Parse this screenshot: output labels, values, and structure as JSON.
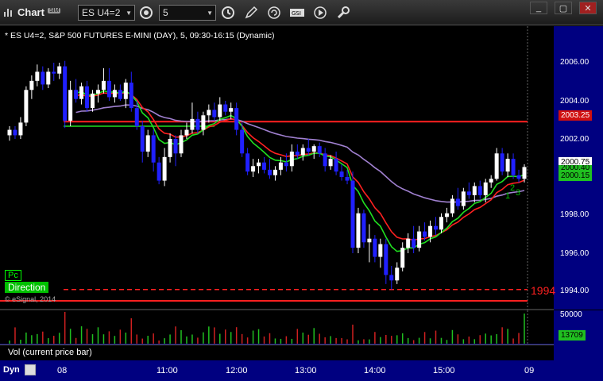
{
  "titlebar": {
    "app_title": "Chart",
    "sim_badge": "SIM",
    "symbol_value": "ES U4=2",
    "interval_value": "5",
    "icons": [
      "link-icon",
      "clock-icon",
      "pencil-icon",
      "refresh-icon",
      "gsi-icon",
      "play-icon",
      "tools-icon"
    ],
    "win_buttons": [
      "_",
      "▢",
      "✕"
    ]
  },
  "chart": {
    "title": "* ES U4=2, S&P 500 FUTURES E-MINI (DAY), 5, 09:30-16:15 (Dynamic)",
    "price_ticks": [
      "2006.00",
      "2004.00",
      "2002.00",
      "2000.00",
      "1998.00",
      "1996.00",
      "1994.00"
    ],
    "price_markers": {
      "red_level": "2003.25",
      "last": "2000.75",
      "green_a": "2000.40",
      "green_b": "2000.15"
    },
    "level_label": "1994",
    "pc_label": "Pc",
    "direction_label": "Direction",
    "copyright": "© eSignal, 2014",
    "counts": [
      "1",
      "2",
      "3"
    ],
    "time_ticks": [
      "08",
      "11:00",
      "12:00",
      "13:00",
      "14:00",
      "15:00",
      "09"
    ]
  },
  "volume": {
    "label": "Vol (current price bar)",
    "scale": "50000",
    "current": "13709"
  },
  "footer": {
    "dyn_label": "Dyn"
  },
  "colors": {
    "up": "#ffffff",
    "down": "#2020ff",
    "ma_red": "#ff2020",
    "ma_green": "#20e020",
    "ma_purple": "#a080d0",
    "axis_bg": "#000080"
  },
  "chart_data": {
    "type": "candlestick",
    "ylim": [
      1993.2,
      2007.2
    ],
    "levels": {
      "resistance": 2003.25,
      "support": 1994.0,
      "green_level": 2003.0
    },
    "candles": [
      [
        2002.5,
        2003.0,
        2002.2,
        2002.8
      ],
      [
        2002.8,
        2003.0,
        2002.3,
        2002.5
      ],
      [
        2002.5,
        2003.5,
        2002.3,
        2003.2
      ],
      [
        2003.2,
        2005.2,
        2003.0,
        2005.0
      ],
      [
        2005.0,
        2005.8,
        2004.5,
        2005.5
      ],
      [
        2005.5,
        2006.4,
        2005.2,
        2006.0
      ],
      [
        2006.0,
        2006.3,
        2005.0,
        2005.3
      ],
      [
        2005.3,
        2006.2,
        2005.1,
        2006.0
      ],
      [
        2006.0,
        2006.5,
        2005.5,
        2005.9
      ],
      [
        2005.9,
        2006.5,
        2005.6,
        2006.3
      ],
      [
        2006.3,
        2006.6,
        2002.9,
        2003.3
      ],
      [
        2003.3,
        2005.5,
        2003.0,
        2005.0
      ],
      [
        2005.0,
        2005.6,
        2004.3,
        2004.5
      ],
      [
        2004.5,
        2005.4,
        2004.2,
        2005.2
      ],
      [
        2005.2,
        2005.5,
        2003.8,
        2004.0
      ],
      [
        2004.0,
        2005.0,
        2003.8,
        2004.8
      ],
      [
        2004.8,
        2005.3,
        2004.3,
        2005.0
      ],
      [
        2005.0,
        2006.2,
        2004.8,
        2005.5
      ],
      [
        2005.5,
        2006.2,
        2004.4,
        2004.6
      ],
      [
        2004.6,
        2005.3,
        2004.3,
        2005.0
      ],
      [
        2005.0,
        2005.3,
        2004.4,
        2004.5
      ],
      [
        2004.5,
        2005.6,
        2004.0,
        2005.4
      ],
      [
        2005.4,
        2006.0,
        2003.8,
        2004.0
      ],
      [
        2004.0,
        2004.4,
        2002.8,
        2003.0
      ],
      [
        2003.0,
        2003.3,
        2001.0,
        2001.6
      ],
      [
        2001.6,
        2002.8,
        2001.3,
        2002.5
      ],
      [
        2002.5,
        2002.8,
        2000.5,
        2001.0
      ],
      [
        2001.0,
        2001.3,
        1999.8,
        2000.0
      ],
      [
        2000.0,
        2001.8,
        1999.7,
        2001.3
      ],
      [
        2001.3,
        2002.6,
        2001.0,
        2002.3
      ],
      [
        2002.3,
        2002.5,
        2000.8,
        2001.5
      ],
      [
        2001.5,
        2002.8,
        2001.3,
        2002.5
      ],
      [
        2002.5,
        2003.2,
        2002.3,
        2002.8
      ],
      [
        2002.8,
        2004.3,
        2002.6,
        2003.4
      ],
      [
        2003.4,
        2003.8,
        2002.6,
        2002.8
      ],
      [
        2002.8,
        2003.8,
        2002.5,
        2003.6
      ],
      [
        2003.6,
        2004.2,
        2003.2,
        2003.9
      ],
      [
        2003.9,
        2004.3,
        2003.3,
        2003.5
      ],
      [
        2003.5,
        2004.6,
        2003.3,
        2004.2
      ],
      [
        2004.2,
        2004.4,
        2003.6,
        2003.8
      ],
      [
        2003.8,
        2004.3,
        2003.4,
        2004.0
      ],
      [
        2004.0,
        2004.3,
        2002.5,
        2002.8
      ],
      [
        2002.8,
        2003.2,
        2001.3,
        2001.5
      ],
      [
        2001.5,
        2001.8,
        2000.3,
        2000.5
      ],
      [
        2000.5,
        2001.2,
        2000.2,
        2000.8
      ],
      [
        2000.8,
        2001.2,
        2000.4,
        2001.0
      ],
      [
        2001.0,
        2001.3,
        2000.4,
        2000.6
      ],
      [
        2000.6,
        2001.2,
        2000.1,
        2000.3
      ],
      [
        2000.3,
        2000.8,
        2000.0,
        2000.6
      ],
      [
        2000.6,
        2001.3,
        2000.3,
        2001.0
      ],
      [
        2001.0,
        2001.5,
        2000.5,
        2000.8
      ],
      [
        2000.8,
        2002.0,
        2000.5,
        2001.6
      ],
      [
        2001.6,
        2002.0,
        2001.2,
        2001.4
      ],
      [
        2001.4,
        2002.0,
        2001.1,
        2001.8
      ],
      [
        2001.8,
        2002.3,
        2001.4,
        2001.6
      ],
      [
        2001.6,
        2002.0,
        2001.2,
        2001.9
      ],
      [
        2001.9,
        2002.1,
        2001.3,
        2001.5
      ],
      [
        2001.5,
        2001.8,
        2000.5,
        2000.8
      ],
      [
        2000.8,
        2001.4,
        2000.6,
        2001.2
      ],
      [
        2001.2,
        2001.6,
        2000.3,
        2000.5
      ],
      [
        2000.5,
        2000.9,
        2000.0,
        2000.2
      ],
      [
        2000.2,
        2000.6,
        1999.8,
        2000.0
      ],
      [
        2000.0,
        2000.5,
        1996.0,
        1996.3
      ],
      [
        1996.3,
        1998.5,
        1996.0,
        1998.2
      ],
      [
        1998.2,
        1998.4,
        1996.3,
        1996.6
      ],
      [
        1996.6,
        1997.6,
        1995.5,
        1996.8
      ],
      [
        1996.8,
        1997.0,
        1995.5,
        1995.8
      ],
      [
        1995.8,
        1996.8,
        1995.2,
        1996.5
      ],
      [
        1996.5,
        1996.8,
        1994.3,
        1994.8
      ],
      [
        1994.8,
        1995.3,
        1994.0,
        1994.5
      ],
      [
        1994.5,
        1995.5,
        1994.3,
        1995.2
      ],
      [
        1995.2,
        1996.6,
        1995.0,
        1996.3
      ],
      [
        1996.3,
        1997.1,
        1996.0,
        1996.8
      ],
      [
        1996.8,
        1997.5,
        1996.0,
        1996.3
      ],
      [
        1996.3,
        1997.5,
        1996.1,
        1997.2
      ],
      [
        1997.2,
        1997.7,
        1996.7,
        1996.9
      ],
      [
        1996.9,
        1997.8,
        1996.6,
        1997.5
      ],
      [
        1997.5,
        1998.0,
        1997.0,
        1997.3
      ],
      [
        1997.3,
        1998.2,
        1997.1,
        1998.0
      ],
      [
        1998.0,
        1998.5,
        1997.7,
        1998.2
      ],
      [
        1998.2,
        1999.2,
        1998.0,
        1999.0
      ],
      [
        1999.0,
        1999.6,
        1998.4,
        1998.6
      ],
      [
        1998.6,
        1999.6,
        1998.4,
        1999.4
      ],
      [
        1999.4,
        1999.9,
        1999.0,
        1999.2
      ],
      [
        1999.2,
        1999.9,
        1998.8,
        1999.7
      ],
      [
        1999.7,
        2000.0,
        1999.0,
        1999.2
      ],
      [
        1999.2,
        2000.1,
        1998.8,
        1999.9
      ],
      [
        1999.9,
        2000.3,
        1999.6,
        2000.1
      ],
      [
        2000.1,
        2001.8,
        2000.0,
        2001.5
      ],
      [
        2001.5,
        2001.8,
        2000.3,
        2000.5
      ],
      [
        2000.5,
        2001.5,
        2000.2,
        2001.2
      ],
      [
        2001.2,
        2001.5,
        2000.1,
        2000.3
      ],
      [
        2000.3,
        2000.6,
        1999.9,
        2000.1
      ],
      [
        2000.1,
        2000.9,
        1999.9,
        2000.75
      ]
    ],
    "volume_scale": 50000,
    "volume_current": 13709
  }
}
